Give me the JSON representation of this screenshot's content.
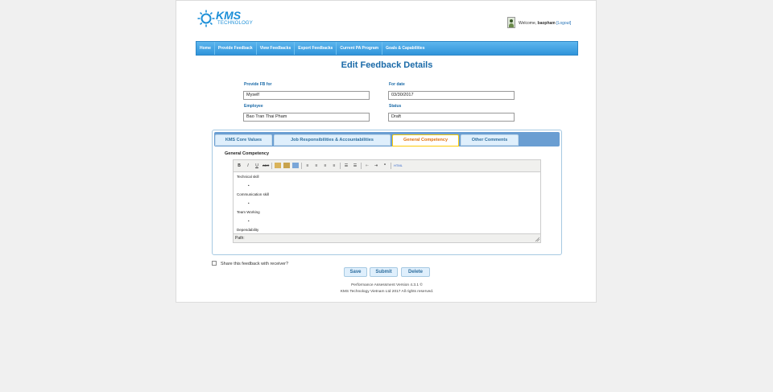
{
  "logo": {
    "brand": "KMS",
    "sub": "TECHNOLOGY"
  },
  "user": {
    "welcome": "Welcome,",
    "name": "baopham",
    "logout": "[Logout]"
  },
  "nav": [
    "Home",
    "Provide Feedback",
    "View Feedbacks",
    "Export Feedbacks",
    "Current PA Program",
    "Goals & Capabilities"
  ],
  "page_title": "Edit Feedback Details",
  "form": {
    "provide_for_label": "Provide FB for",
    "provide_for_value": "Myself",
    "for_date_label": "For date",
    "for_date_value": "03/30/2017",
    "employee_label": "Employee",
    "employee_value": "Bao Tran Thai Pham",
    "status_label": "Status",
    "status_value": "Draft"
  },
  "tabs": [
    "KMS Core Values",
    "Job Responsibilities & Accountabilities",
    "General Competency",
    "Other Comments"
  ],
  "active_tab": "General Competency",
  "section_title": "General Competency",
  "editor": {
    "lines": [
      "Technical skill",
      "•",
      "Communication skill",
      "•",
      "Team Working",
      "•",
      "Dependability"
    ],
    "path_label": "Path:"
  },
  "share_label": "Share this feedback with receiver?",
  "buttons": {
    "save": "Save",
    "submit": "Submit",
    "delete": "Delete"
  },
  "footer": {
    "line1": "Performance Assessment Version 4.3.1 ©",
    "line2": "KMS Technology Vietnam Ltd 2017 All rights reserved."
  },
  "colors": {
    "accent": "#1a6aa8",
    "nav": "#3a9de0",
    "active_tab": "#e17009"
  }
}
